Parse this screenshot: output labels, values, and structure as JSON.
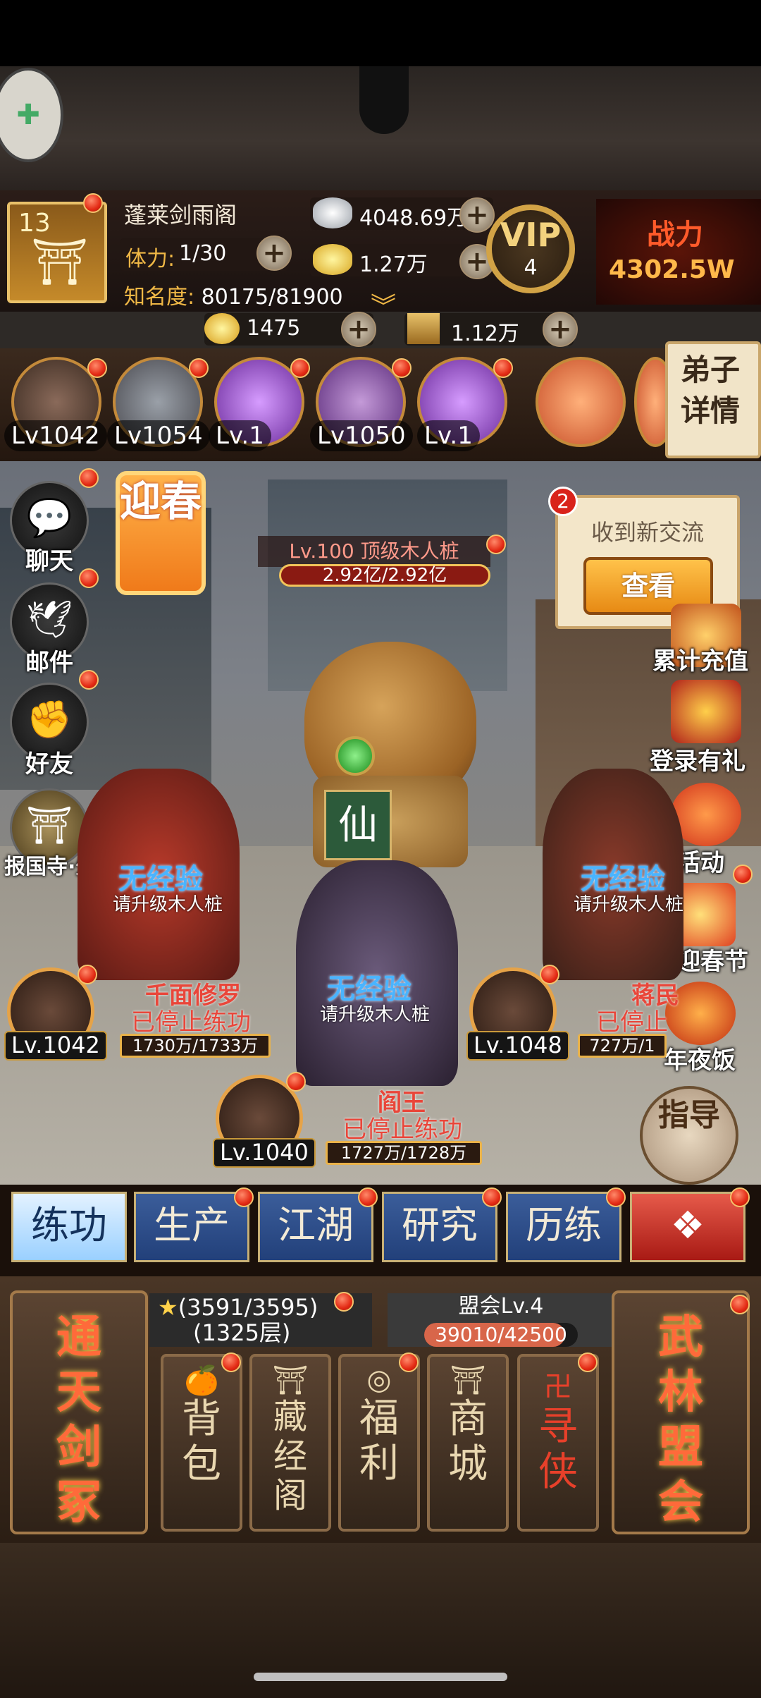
{
  "header": {
    "sect_level": "13",
    "sect_name": "蓬莱剑雨阁",
    "stamina_label": "体力:",
    "stamina_value": "1/30",
    "fame_label": "知名度:",
    "fame_value": "80175/81900",
    "silver": "4048.69万",
    "gold_bars": "1.27万",
    "vip_label": "VIP",
    "vip_level": "4",
    "combat_label": "战力",
    "combat_value": "4302.5W"
  },
  "subbar": {
    "ingots": "1475",
    "tokens": "1.12万"
  },
  "disciples": {
    "levels": [
      "Lv1042",
      "Lv1054",
      "Lv.1",
      "Lv1050",
      "Lv.1"
    ],
    "detail_label": "弟子详情"
  },
  "side_menu": {
    "chat": "聊天",
    "mail": "邮件",
    "friends": "好友",
    "temple": "报国寺·外"
  },
  "event": {
    "spring": "迎春"
  },
  "stake": {
    "title": "Lv.100 顶级木人桩",
    "hp": "2.92亿/2.92亿"
  },
  "notice": {
    "badge": "2",
    "text": "收到新交流",
    "button": "查看"
  },
  "right_menu": {
    "recharge": "累计充值",
    "login": "登录有礼",
    "activity": "活动",
    "spring_festival": "喜迎春节",
    "dinner": "年夜饭"
  },
  "scene": {
    "no_exp": "无经验",
    "upgrade_hint": "请升级木人桩",
    "fighters": [
      {
        "name": "千面修罗",
        "state": "已停止练功",
        "level": "Lv.1042",
        "hp": "1730万/1733万"
      },
      {
        "name": "蒋民",
        "state": "已停止练功",
        "level": "Lv.1048",
        "hp": "727万/1"
      },
      {
        "name": "阎王",
        "state": "已停止练功",
        "level": "Lv.1040",
        "hp": "1727万/1728万"
      }
    ],
    "fighter_state_left": "已停止练功",
    "fighter_state_right": "已停止"
  },
  "guide": {
    "label": "指导"
  },
  "tabs": [
    "练功",
    "生产",
    "江湖",
    "研究",
    "历练"
  ],
  "bottom": {
    "tower_stars": "(3591/3595)",
    "tower_floor": "(1325层)",
    "tower_big": "通天剑冢",
    "league_title": "盟会Lv.4",
    "league_progress": "39010/42500",
    "league_fraction": 0.918,
    "league_big": "武林盟会",
    "cards": [
      {
        "icon": "🍊",
        "label": "背包"
      },
      {
        "icon": "⛩",
        "label": "藏经阁"
      },
      {
        "icon": "◎",
        "label": "福利"
      },
      {
        "icon": "⛩",
        "label": "商城"
      },
      {
        "icon": "卍",
        "label": "寻侠"
      }
    ]
  }
}
